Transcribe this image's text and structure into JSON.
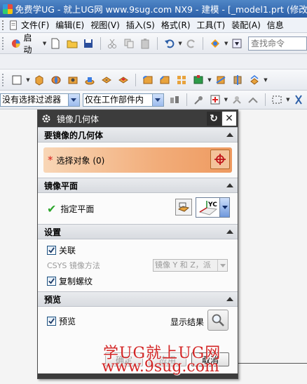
{
  "window": {
    "title": "免费学UG - 就上UG网 www.9sug.com   NX9 - 建模 - [_model1.prt  (修改的"
  },
  "menu": {
    "items": [
      "文件(F)",
      "编辑(E)",
      "视图(V)",
      "插入(S)",
      "格式(R)",
      "工具(T)",
      "装配(A)",
      "信息"
    ]
  },
  "toolbar": {
    "start_label": "启动",
    "search_placeholder": "查找命令"
  },
  "filters": {
    "selection_filter": "没有选择过滤器",
    "scope": "仅在工作部件内"
  },
  "dialog": {
    "title": "镜像几何体",
    "sections": {
      "geometry": {
        "header": "要镜像的几何体",
        "select_label": "选择对象 (0)",
        "required_mark": "*"
      },
      "plane": {
        "header": "镜像平面",
        "specify_label": "指定平面",
        "plane_option": "YC"
      },
      "settings": {
        "header": "设置",
        "associative_label": "关联",
        "associative_checked": true,
        "csys_label": "CSYS 镜像方法",
        "csys_value": "镜像 Y 和 Z，派",
        "copy_threads_label": "复制螺纹",
        "copy_threads_checked": true
      },
      "preview": {
        "header": "预览",
        "preview_label": "预览",
        "preview_checked": true,
        "show_result_label": "显示结果"
      }
    },
    "buttons": {
      "ok": "确定",
      "apply": "应用",
      "cancel": "取消"
    }
  },
  "watermark": {
    "line1": "学UG就上UG网",
    "line2": "www.9sug.com"
  },
  "colors": {
    "title_bar": "#2b5ea7",
    "dialog_title_bar": "#3c3c3c",
    "selection_highlight": "#f2ad7a",
    "watermark": "#d11b1b"
  }
}
